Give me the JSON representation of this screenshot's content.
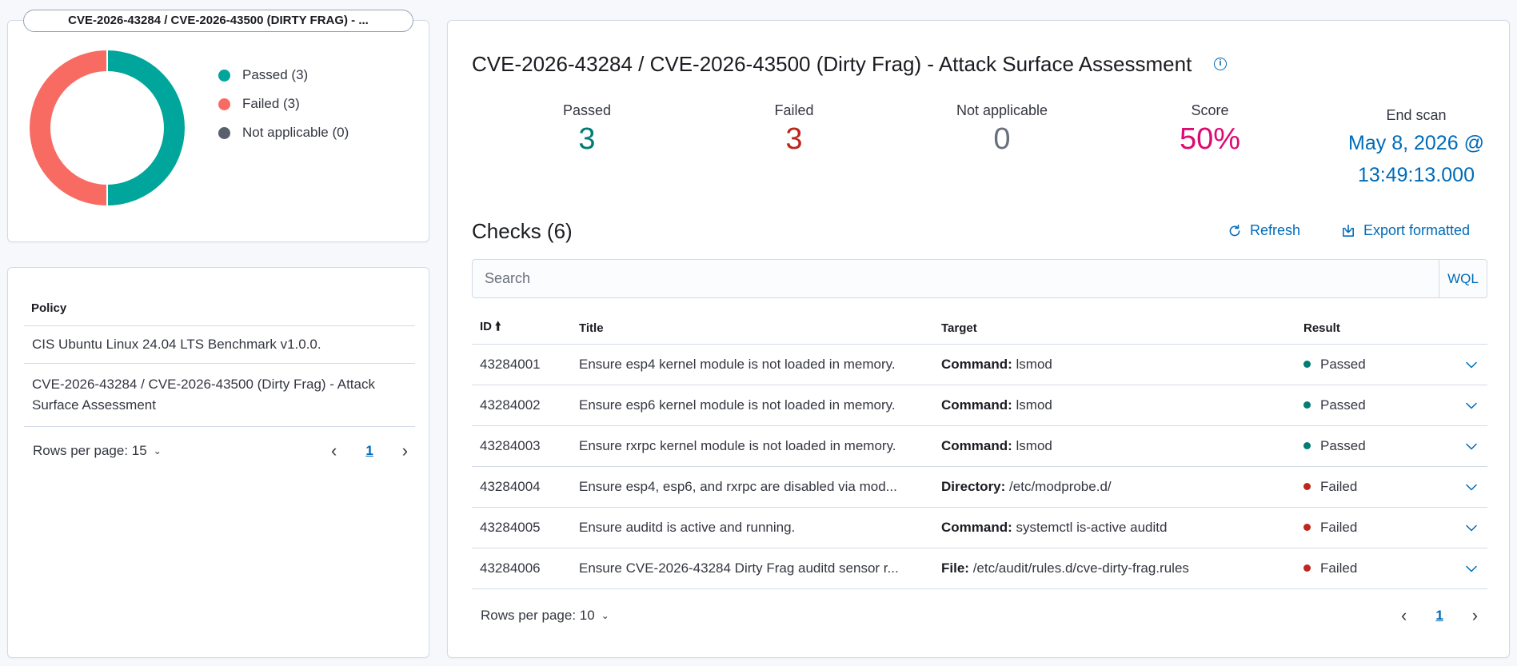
{
  "donut": {
    "title": "CVE-2026-43284 / CVE-2026-43500 (DIRTY FRAG) - ...",
    "colors": {
      "passed": "#00a69b",
      "failed": "#f86b63",
      "not_applicable": "#5a606b"
    },
    "legend": [
      {
        "label": "Passed (3)",
        "value": 3,
        "color": "#00a69b"
      },
      {
        "label": "Failed (3)",
        "value": 3,
        "color": "#f86b63"
      },
      {
        "label": "Not applicable (0)",
        "value": 0,
        "color": "#5a606b"
      }
    ]
  },
  "policies": {
    "header": "Policy",
    "rows": [
      "CIS Ubuntu Linux 24.04 LTS Benchmark v1.0.0.",
      "CVE-2026-43284 / CVE-2026-43500 (Dirty Frag) - Attack Surface Assessment"
    ],
    "rows_per_page": "Rows per page: 15",
    "page": "1"
  },
  "assessment": {
    "title": "CVE-2026-43284 / CVE-2026-43500 (Dirty Frag) - Attack Surface Assessment",
    "stats": {
      "passed_label": "Passed",
      "passed_value": "3",
      "failed_label": "Failed",
      "failed_value": "3",
      "na_label": "Not applicable",
      "na_value": "0",
      "score_label": "Score",
      "score_value": "50%",
      "end_label": "End scan",
      "end_line1": "May 8, 2026 @",
      "end_line2": "13:49:13.000"
    },
    "colors": {
      "passed": "#017d73",
      "failed": "#bd271e",
      "na": "#69707d",
      "score": "#dd0a73",
      "date": "#006bb8"
    }
  },
  "checks": {
    "title": "Checks (6)",
    "refresh_label": "Refresh",
    "export_label": "Export formatted",
    "search_placeholder": "Search",
    "wql_label": "WQL",
    "columns": {
      "id": "ID",
      "title": "Title",
      "target": "Target",
      "result": "Result"
    },
    "rows": [
      {
        "id": "43284001",
        "title": "Ensure esp4 kernel module is not loaded in memory.",
        "target_label": "Command:",
        "target_value": "lsmod",
        "result": "Passed"
      },
      {
        "id": "43284002",
        "title": "Ensure esp6 kernel module is not loaded in memory.",
        "target_label": "Command:",
        "target_value": "lsmod",
        "result": "Passed"
      },
      {
        "id": "43284003",
        "title": "Ensure rxrpc kernel module is not loaded in memory.",
        "target_label": "Command:",
        "target_value": "lsmod",
        "result": "Passed"
      },
      {
        "id": "43284004",
        "title": "Ensure esp4, esp6, and rxrpc are disabled via mod...",
        "target_label": "Directory:",
        "target_value": "/etc/modprobe.d/",
        "result": "Failed"
      },
      {
        "id": "43284005",
        "title": "Ensure auditd is active and running.",
        "target_label": "Command:",
        "target_value": "systemctl is-active auditd",
        "result": "Failed"
      },
      {
        "id": "43284006",
        "title": "Ensure CVE-2026-43284 Dirty Frag auditd sensor r...",
        "target_label": "File:",
        "target_value": "/etc/audit/rules.d/cve-dirty-frag.rules",
        "result": "Failed"
      }
    ],
    "result_colors": {
      "Passed": "#017d73",
      "Failed": "#bd271e"
    },
    "rows_per_page": "Rows per page: 10",
    "page": "1"
  }
}
